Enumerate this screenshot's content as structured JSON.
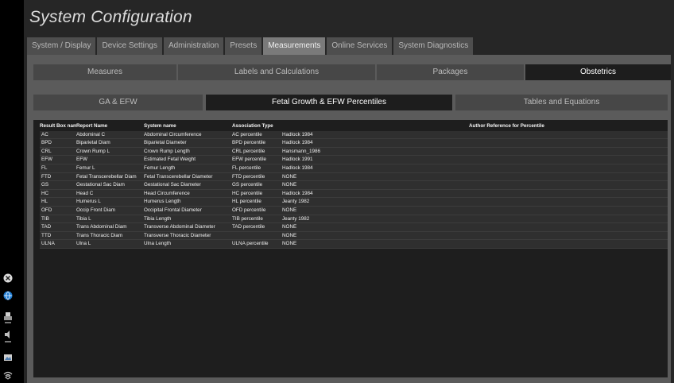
{
  "window": {
    "title": "System Configuration"
  },
  "tabs": [
    {
      "label": "System / Display",
      "active": false
    },
    {
      "label": "Device Settings",
      "active": false
    },
    {
      "label": "Administration",
      "active": false
    },
    {
      "label": "Presets",
      "active": false
    },
    {
      "label": "Measurements",
      "active": true
    },
    {
      "label": "Online Services",
      "active": false
    },
    {
      "label": "System Diagnostics",
      "active": false
    }
  ],
  "subtabs": [
    {
      "label": "Measures",
      "active": false
    },
    {
      "label": "Labels and Calculations",
      "active": false
    },
    {
      "label": "Packages",
      "active": false
    },
    {
      "label": "Obstetrics",
      "active": true
    }
  ],
  "third_tabs": [
    {
      "label": "GA & EFW",
      "active": false
    },
    {
      "label": "Fetal Growth & EFW Percentiles",
      "active": true
    },
    {
      "label": "Tables and Equations",
      "active": false
    }
  ],
  "table": {
    "headers": [
      "Result Box name",
      "Report Name",
      "System name",
      "Association Type",
      "Author Reference for Percentile"
    ],
    "rows": [
      [
        "AC",
        "Abdominal C",
        "Abdominal Circumference",
        "AC percentile",
        "Hadlock 1984"
      ],
      [
        "BPD",
        "Biparietal Diam",
        "Biparietal Diameter",
        "BPD percentile",
        "Hadlock 1984"
      ],
      [
        "CRL",
        "Crown Rump L",
        "Crown Rump Length",
        "CRL percentile",
        "Hansmann_1986"
      ],
      [
        "EFW",
        "EFW",
        "Estimated Fetal Weight",
        "EFW percentile",
        "Hadlock 1991"
      ],
      [
        "FL",
        "Femur L",
        "Femur Length",
        "FL percentile",
        "Hadlock 1984"
      ],
      [
        "FTD",
        "Fetal Transcerebellar Diam",
        "Fetal Transcerebellar Diameter",
        "FTD percentile",
        "NONE"
      ],
      [
        "GS",
        "Gestational Sac Diam",
        "Gestational Sac Diameter",
        "GS percentile",
        "NONE"
      ],
      [
        "HC",
        "Head C",
        "Head Circumference",
        "HC percentile",
        "Hadlock 1984"
      ],
      [
        "HL",
        "Humerus L",
        "Humerus Length",
        "HL percentile",
        "Jeanty 1982"
      ],
      [
        "OFD",
        "Occip Front Diam",
        "Occipital Frontal Diameter",
        "OFD percentile",
        "NONE"
      ],
      [
        "TIB",
        "Tibia L",
        "Tibia Length",
        "TIB percentile",
        "Jeanty 1982"
      ],
      [
        "TAD",
        "Trans Abdominal Diam",
        "Transverse Abdominal Diameter",
        "TAD percentile",
        "NONE"
      ],
      [
        "TTD",
        "Trans Thoracic Diam",
        "Transverse Thoracic Diameter",
        "",
        "NONE"
      ],
      [
        "ULNA",
        "Ulna L",
        "Ulna Length",
        "ULNA percentile",
        "NONE"
      ]
    ]
  },
  "left_icons": [
    "close-icon",
    "globe-icon",
    "print-icon",
    "audio-icon",
    "image-icon",
    "wifi-icon"
  ],
  "colors": {
    "active_tab": "#7a7a7a",
    "active_subtab": "#1d1d1d",
    "panel": "#5b5b5b",
    "table_bg": "#1e1e1e"
  }
}
